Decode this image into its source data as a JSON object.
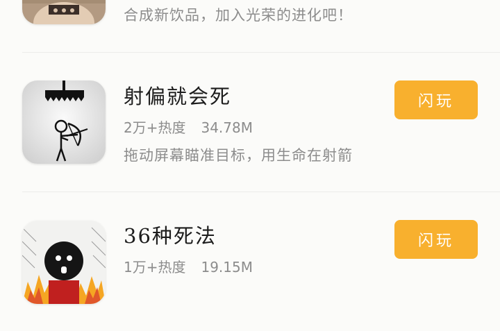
{
  "games": [
    {
      "title": "",
      "meta": "",
      "size": "",
      "description": "合成新饮品，加入光荣的进化吧！",
      "button": ""
    },
    {
      "title": "射偏就会死",
      "meta": "2万+热度",
      "size": "34.78M",
      "description": "拖动屏幕瞄准目标，用生命在射箭",
      "button": "闪玩"
    },
    {
      "title": "36种死法",
      "meta": "1万+热度",
      "size": "19.15M",
      "description": "",
      "button": "闪玩"
    }
  ],
  "colors": {
    "play_button": "#f8b02e",
    "background": "#fbfbf9",
    "muted_text": "#8c8c8c"
  }
}
